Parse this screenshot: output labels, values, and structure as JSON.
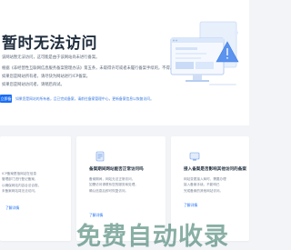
{
  "hero": {
    "title": "暂时无法访问",
    "lines": [
      "该网站暂无法访问，这可能是由于该网站尚未进行备案。",
      "根据《非经营性互联网信息服务备案管理办法》第五条，未取得许可或者未履行备案手续的，不得从事互联网信息服务。",
      "如果您是网站所有者，请尽快为网站进行ICP备案。",
      "如果您是网站访问者，请稍后再试。"
    ],
    "button_label": "立即备案",
    "hint": "如果您是网站的所有者，且已完成备案，请前往备案管理中心，更新备案信息以恢复访问。"
  },
  "cards": [
    {
      "title": "",
      "desc": [
        "ICP备案是指网站在信息",
        "管理部门进行登记备案，",
        "以确保网站内容合法合规，",
        "未备案网站将无法访问。"
      ],
      "link": "了解详情"
    },
    {
      "title": "备案期间网站能否正常访问吗",
      "desc": [
        "备案期间，网站无法正常访问，",
        "如需访问请联系您的服务商处理，",
        "确认信息后即可恢复访问。"
      ],
      "link": "了解详情"
    },
    {
      "title": "接入备案是否影响其他访问的备案",
      "desc": [
        "网站变更接入商时，需要办理",
        "接入备案手续，不影响已",
        "完成备案的其他网站访问。"
      ],
      "link": "了解详情"
    }
  ],
  "watermark": "免费自动收录",
  "colors": {
    "primary": "#1a6ef5",
    "title": "#1f2d3d",
    "background": "#f2f4f7"
  }
}
